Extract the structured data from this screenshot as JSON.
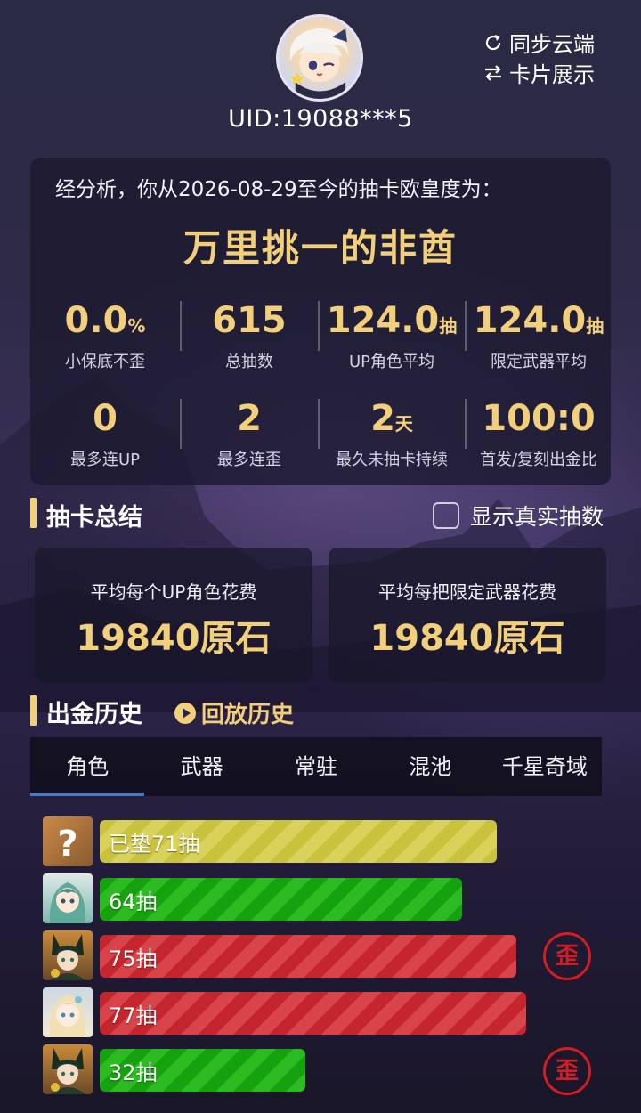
{
  "header": {
    "uid": "UID:19088***5",
    "sync_label": "同步云端",
    "card_label": "卡片展示",
    "avatar_icon": "paimon-avatar"
  },
  "luck": {
    "intro": "经分析，你从2026-08-29至今的抽卡欧皇度为：",
    "title": "万里挑一的非酋",
    "stats": [
      {
        "value": "0.0",
        "unit": "%",
        "label": "小保底不歪"
      },
      {
        "value": "615",
        "unit": "",
        "label": "总抽数"
      },
      {
        "value": "124.0",
        "unit": "抽",
        "label": "UP角色平均"
      },
      {
        "value": "124.0",
        "unit": "抽",
        "label": "限定武器平均"
      },
      {
        "value": "0",
        "unit": "",
        "label": "最多连UP"
      },
      {
        "value": "2",
        "unit": "",
        "label": "最多连歪"
      },
      {
        "value": "2",
        "unit": "天",
        "label": "最久未抽卡持续"
      },
      {
        "value": "100:0",
        "unit": "",
        "label": "首发/复刻出金比"
      }
    ],
    "accent_color": "#f2cf7a"
  },
  "summary": {
    "title": "抽卡总结",
    "checkbox_label": "显示真实抽数",
    "checkbox_checked": false,
    "cards": [
      {
        "label": "平均每个UP角色花费",
        "value": "19840原石"
      },
      {
        "label": "平均每把限定武器花费",
        "value": "19840原石"
      }
    ]
  },
  "history": {
    "title": "出金历史",
    "replay_label": "回放历史",
    "tabs": [
      "角色",
      "武器",
      "常驻",
      "混池",
      "千星奇域"
    ],
    "active_tab": 0,
    "rows": [
      {
        "label": "已垫71抽",
        "color": "yellow",
        "off_banner": false,
        "avatar": "unknown-avatar",
        "pulls": 71
      },
      {
        "label": "64抽",
        "color": "green",
        "off_banner": false,
        "avatar": "character-avatar",
        "pulls": 64
      },
      {
        "label": "75抽",
        "color": "red",
        "off_banner": true,
        "avatar": "character-avatar",
        "pulls": 75
      },
      {
        "label": "77抽",
        "color": "red",
        "off_banner": false,
        "avatar": "character-avatar",
        "pulls": 77
      },
      {
        "label": "32抽",
        "color": "green",
        "off_banner": true,
        "avatar": "character-avatar",
        "pulls": 32
      }
    ],
    "off_banner_mark": "歪"
  }
}
